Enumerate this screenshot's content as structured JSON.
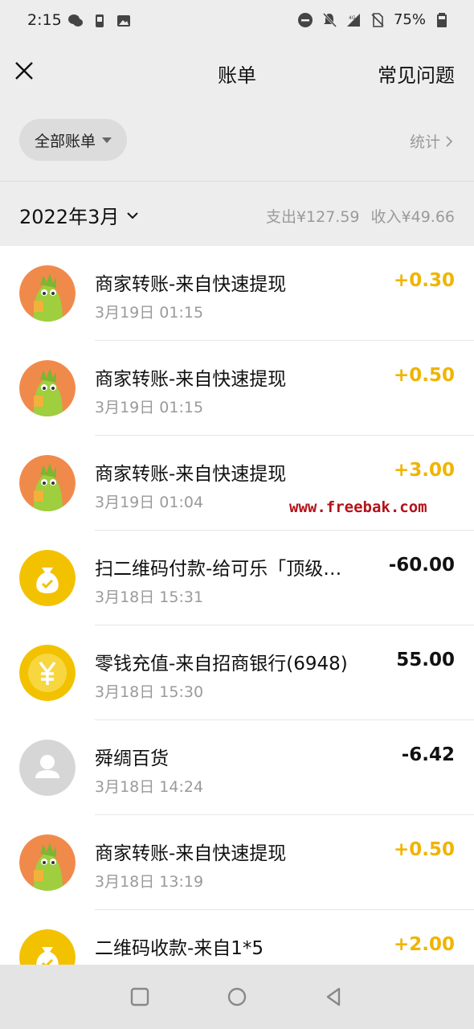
{
  "status": {
    "time": "2:15",
    "network": "4G",
    "battery": "75%",
    "left_icons": [
      "wechat-icon",
      "phone-icon",
      "image-icon"
    ],
    "right_icons": [
      "dnd-icon",
      "mute-icon",
      "signal-icon",
      "no-sim-icon",
      "battery-icon"
    ]
  },
  "nav": {
    "title": "账单",
    "faq": "常见问题",
    "close_icon": "close-icon"
  },
  "filter": {
    "all_bills": "全部账单",
    "stats": "统计"
  },
  "month": {
    "label": "2022年3月",
    "expense": "支出¥127.59",
    "income": "收入¥49.66"
  },
  "transactions": [
    {
      "title": "商家转账-来自快速提现",
      "date": "3月19日 01:15",
      "amount": "+0.30",
      "type": "income",
      "icon": "dragon-avatar"
    },
    {
      "title": "商家转账-来自快速提现",
      "date": "3月19日 01:15",
      "amount": "+0.50",
      "type": "income",
      "icon": "dragon-avatar"
    },
    {
      "title": "商家转账-来自快速提现",
      "date": "3月19日 01:04",
      "amount": "+3.00",
      "type": "income",
      "icon": "dragon-avatar"
    },
    {
      "title": "扫二维码付款-给可乐「顶级…",
      "date": "3月18日 15:31",
      "amount": "-60.00",
      "type": "expense",
      "icon": "money-bag-icon"
    },
    {
      "title": "零钱充值-来自招商银行(6948)",
      "date": "3月18日 15:30",
      "amount": "55.00",
      "type": "neutral",
      "icon": "yuan-coin-icon"
    },
    {
      "title": "舜绸百货",
      "date": "3月18日 14:24",
      "amount": "-6.42",
      "type": "expense",
      "icon": "default-user-avatar"
    },
    {
      "title": "商家转账-来自快速提现",
      "date": "3月18日 13:19",
      "amount": "+0.50",
      "type": "income",
      "icon": "dragon-avatar"
    },
    {
      "title": "二维码收款-来自1*5",
      "date": "",
      "amount": "+2.00",
      "type": "income",
      "icon": "money-bag-icon"
    }
  ],
  "watermark": "www.freebak.com",
  "colors": {
    "income": "#f0b400",
    "expense": "#111111",
    "background": "#ededed",
    "accent_yellow": "#f2c200"
  }
}
